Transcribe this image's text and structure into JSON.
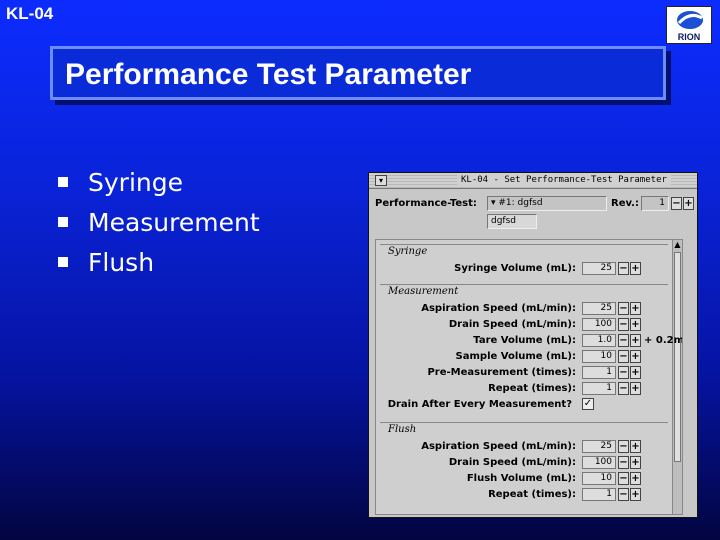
{
  "slide": {
    "id": "KL-04",
    "title": "Performance Test Parameter",
    "logo_text": "RION",
    "bullets": [
      "Syringe",
      "Measurement",
      "Flush"
    ]
  },
  "colors": {
    "background": "#0a23d8",
    "title_box": "#0a2bd8",
    "window": "#c8c8c8"
  },
  "dialog": {
    "title": "KL-04 - Set Performance-Test Parameter",
    "performance_test_label": "Performance-Test:",
    "performance_test_value": "#1: dgfsd",
    "description_value": "dgfsd",
    "rev_label": "Rev.:",
    "rev_value": "1",
    "sections": {
      "syringe": {
        "header": "Syringe",
        "rows": [
          {
            "label": "Syringe Volume (mL):",
            "value": "25"
          }
        ]
      },
      "measurement": {
        "header": "Measurement",
        "rows": [
          {
            "label": "Aspiration Speed (mL/min):",
            "value": "25"
          },
          {
            "label": "Drain Speed (mL/min):",
            "value": "100"
          },
          {
            "label": "Tare Volume (mL):",
            "value": "1.0",
            "extra": "+ 0.2m"
          },
          {
            "label": "Sample Volume (mL):",
            "value": "10"
          },
          {
            "label": "Pre-Measurement (times):",
            "value": "1"
          },
          {
            "label": "Repeat (times):",
            "value": "1"
          }
        ],
        "drain_after_label": "Drain After Every Measurement?",
        "drain_after_checked": true
      },
      "flush": {
        "header": "Flush",
        "rows": [
          {
            "label": "Aspiration Speed (mL/min):",
            "value": "25"
          },
          {
            "label": "Drain Speed (mL/min):",
            "value": "100"
          },
          {
            "label": "Flush Volume (mL):",
            "value": "10"
          },
          {
            "label": "Repeat (times):",
            "value": "1"
          }
        ]
      }
    }
  }
}
